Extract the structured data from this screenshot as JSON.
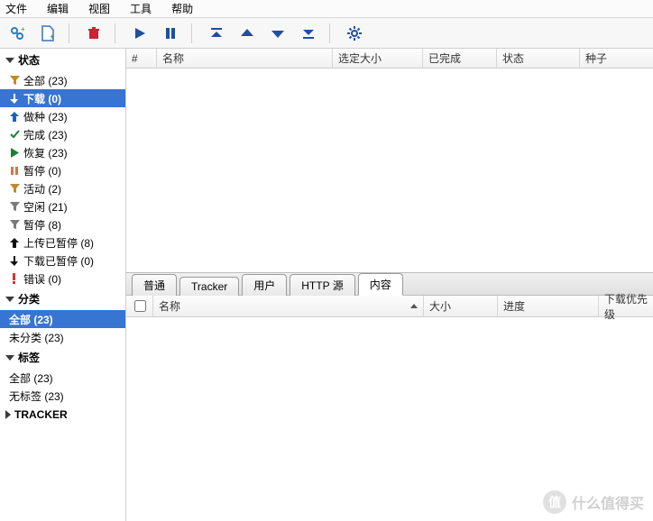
{
  "menu": {
    "file": "文件",
    "edit": "编辑",
    "view": "视图",
    "tools": "工具",
    "help": "帮助"
  },
  "sidebar": {
    "status": {
      "header": "状态",
      "items": [
        {
          "label": "全部 (23)",
          "icon": "funnel",
          "color": "#c08a2e"
        },
        {
          "label": "下载 (0)",
          "icon": "arrow-dn",
          "color": "#1e7e34",
          "selected": true
        },
        {
          "label": "做种 (23)",
          "icon": "arrow-up",
          "color": "#1565c0"
        },
        {
          "label": "完成 (23)",
          "icon": "check",
          "color": "#1e7e34"
        },
        {
          "label": "恢复 (23)",
          "icon": "play",
          "color": "#1e7e34"
        },
        {
          "label": "暂停 (0)",
          "icon": "pause",
          "color": "#d07a45"
        },
        {
          "label": "活动 (2)",
          "icon": "funnel",
          "color": "#c08a2e"
        },
        {
          "label": "空闲 (21)",
          "icon": "funnel",
          "color": "#7a7a7a"
        },
        {
          "label": "暂停 (8)",
          "icon": "funnel",
          "color": "#7a7a7a"
        },
        {
          "label": "上传已暂停 (8)",
          "icon": "arrow-up",
          "color": "#111"
        },
        {
          "label": "下载已暂停 (0)",
          "icon": "arrow-dn",
          "color": "#111"
        },
        {
          "label": "错误 (0)",
          "icon": "bang",
          "color": "#d33"
        }
      ]
    },
    "category": {
      "header": "分类",
      "items": [
        {
          "label": "全部 (23)",
          "selected": true
        },
        {
          "label": "未分类 (23)"
        }
      ]
    },
    "tags": {
      "header": "标签",
      "items": [
        {
          "label": "全部 (23)"
        },
        {
          "label": "无标签 (23)"
        }
      ]
    },
    "tracker": {
      "header": "TRACKER"
    }
  },
  "columns": {
    "num": "#",
    "name": "名称",
    "size": "选定大小",
    "done": "已完成",
    "status": "状态",
    "seeds": "种子"
  },
  "tabs": {
    "general": "普通",
    "tracker": "Tracker",
    "peers": "用户",
    "http": "HTTP 源",
    "content": "内容"
  },
  "content_columns": {
    "name": "名称",
    "size": "大小",
    "progress": "进度",
    "priority": "下载优先级"
  },
  "watermark": {
    "badge": "值",
    "text": "什么值得买"
  }
}
